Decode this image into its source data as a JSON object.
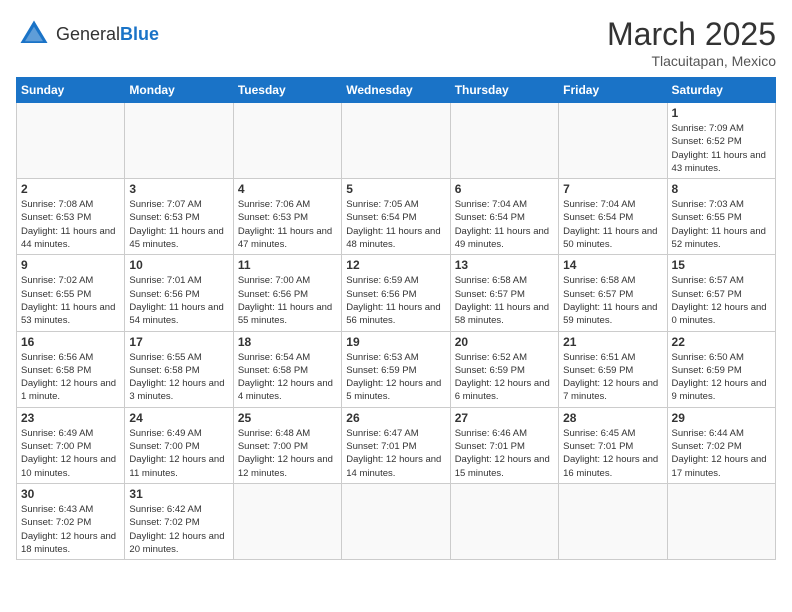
{
  "header": {
    "logo_general": "General",
    "logo_blue": "Blue",
    "month": "March 2025",
    "location": "Tlacuitapan, Mexico"
  },
  "days_of_week": [
    "Sunday",
    "Monday",
    "Tuesday",
    "Wednesday",
    "Thursday",
    "Friday",
    "Saturday"
  ],
  "weeks": [
    [
      {
        "day": "",
        "info": ""
      },
      {
        "day": "",
        "info": ""
      },
      {
        "day": "",
        "info": ""
      },
      {
        "day": "",
        "info": ""
      },
      {
        "day": "",
        "info": ""
      },
      {
        "day": "",
        "info": ""
      },
      {
        "day": "1",
        "info": "Sunrise: 7:09 AM\nSunset: 6:52 PM\nDaylight: 11 hours and 43 minutes."
      }
    ],
    [
      {
        "day": "2",
        "info": "Sunrise: 7:08 AM\nSunset: 6:53 PM\nDaylight: 11 hours and 44 minutes."
      },
      {
        "day": "3",
        "info": "Sunrise: 7:07 AM\nSunset: 6:53 PM\nDaylight: 11 hours and 45 minutes."
      },
      {
        "day": "4",
        "info": "Sunrise: 7:06 AM\nSunset: 6:53 PM\nDaylight: 11 hours and 47 minutes."
      },
      {
        "day": "5",
        "info": "Sunrise: 7:05 AM\nSunset: 6:54 PM\nDaylight: 11 hours and 48 minutes."
      },
      {
        "day": "6",
        "info": "Sunrise: 7:04 AM\nSunset: 6:54 PM\nDaylight: 11 hours and 49 minutes."
      },
      {
        "day": "7",
        "info": "Sunrise: 7:04 AM\nSunset: 6:54 PM\nDaylight: 11 hours and 50 minutes."
      },
      {
        "day": "8",
        "info": "Sunrise: 7:03 AM\nSunset: 6:55 PM\nDaylight: 11 hours and 52 minutes."
      }
    ],
    [
      {
        "day": "9",
        "info": "Sunrise: 7:02 AM\nSunset: 6:55 PM\nDaylight: 11 hours and 53 minutes."
      },
      {
        "day": "10",
        "info": "Sunrise: 7:01 AM\nSunset: 6:56 PM\nDaylight: 11 hours and 54 minutes."
      },
      {
        "day": "11",
        "info": "Sunrise: 7:00 AM\nSunset: 6:56 PM\nDaylight: 11 hours and 55 minutes."
      },
      {
        "day": "12",
        "info": "Sunrise: 6:59 AM\nSunset: 6:56 PM\nDaylight: 11 hours and 56 minutes."
      },
      {
        "day": "13",
        "info": "Sunrise: 6:58 AM\nSunset: 6:57 PM\nDaylight: 11 hours and 58 minutes."
      },
      {
        "day": "14",
        "info": "Sunrise: 6:58 AM\nSunset: 6:57 PM\nDaylight: 11 hours and 59 minutes."
      },
      {
        "day": "15",
        "info": "Sunrise: 6:57 AM\nSunset: 6:57 PM\nDaylight: 12 hours and 0 minutes."
      }
    ],
    [
      {
        "day": "16",
        "info": "Sunrise: 6:56 AM\nSunset: 6:58 PM\nDaylight: 12 hours and 1 minute."
      },
      {
        "day": "17",
        "info": "Sunrise: 6:55 AM\nSunset: 6:58 PM\nDaylight: 12 hours and 3 minutes."
      },
      {
        "day": "18",
        "info": "Sunrise: 6:54 AM\nSunset: 6:58 PM\nDaylight: 12 hours and 4 minutes."
      },
      {
        "day": "19",
        "info": "Sunrise: 6:53 AM\nSunset: 6:59 PM\nDaylight: 12 hours and 5 minutes."
      },
      {
        "day": "20",
        "info": "Sunrise: 6:52 AM\nSunset: 6:59 PM\nDaylight: 12 hours and 6 minutes."
      },
      {
        "day": "21",
        "info": "Sunrise: 6:51 AM\nSunset: 6:59 PM\nDaylight: 12 hours and 7 minutes."
      },
      {
        "day": "22",
        "info": "Sunrise: 6:50 AM\nSunset: 6:59 PM\nDaylight: 12 hours and 9 minutes."
      }
    ],
    [
      {
        "day": "23",
        "info": "Sunrise: 6:49 AM\nSunset: 7:00 PM\nDaylight: 12 hours and 10 minutes."
      },
      {
        "day": "24",
        "info": "Sunrise: 6:49 AM\nSunset: 7:00 PM\nDaylight: 12 hours and 11 minutes."
      },
      {
        "day": "25",
        "info": "Sunrise: 6:48 AM\nSunset: 7:00 PM\nDaylight: 12 hours and 12 minutes."
      },
      {
        "day": "26",
        "info": "Sunrise: 6:47 AM\nSunset: 7:01 PM\nDaylight: 12 hours and 14 minutes."
      },
      {
        "day": "27",
        "info": "Sunrise: 6:46 AM\nSunset: 7:01 PM\nDaylight: 12 hours and 15 minutes."
      },
      {
        "day": "28",
        "info": "Sunrise: 6:45 AM\nSunset: 7:01 PM\nDaylight: 12 hours and 16 minutes."
      },
      {
        "day": "29",
        "info": "Sunrise: 6:44 AM\nSunset: 7:02 PM\nDaylight: 12 hours and 17 minutes."
      }
    ],
    [
      {
        "day": "30",
        "info": "Sunrise: 6:43 AM\nSunset: 7:02 PM\nDaylight: 12 hours and 18 minutes."
      },
      {
        "day": "31",
        "info": "Sunrise: 6:42 AM\nSunset: 7:02 PM\nDaylight: 12 hours and 20 minutes."
      },
      {
        "day": "",
        "info": ""
      },
      {
        "day": "",
        "info": ""
      },
      {
        "day": "",
        "info": ""
      },
      {
        "day": "",
        "info": ""
      },
      {
        "day": "",
        "info": ""
      }
    ]
  ]
}
